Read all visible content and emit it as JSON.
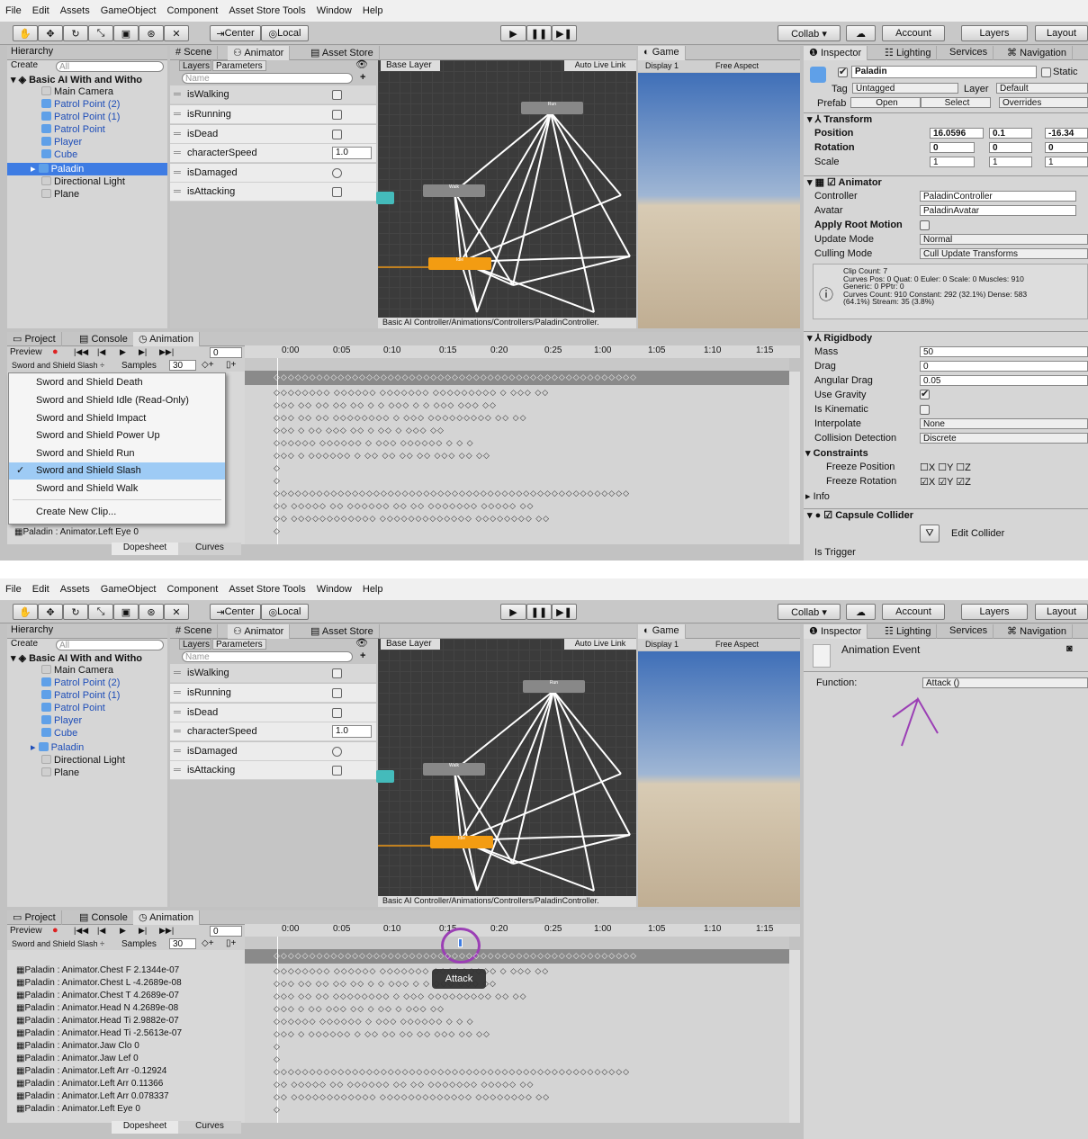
{
  "menu": [
    "File",
    "Edit",
    "Assets",
    "GameObject",
    "Component",
    "Asset Store Tools",
    "Window",
    "Help"
  ],
  "toolbar": {
    "center": "Center",
    "local": "Local",
    "collab": "Collab ▾",
    "account": "Account",
    "layers": "Layers",
    "layout": "Layout"
  },
  "hierarchy": {
    "tab": "Hierarchy",
    "create": "Create",
    "search": "All",
    "scene": "Basic AI With and Witho",
    "items": [
      "Main Camera",
      "Patrol Point (2)",
      "Patrol Point (1)",
      "Patrol Point",
      "Player",
      "Cube",
      "Paladin",
      "Directional Light",
      "Plane"
    ]
  },
  "center_tabs": {
    "scene": "Scene",
    "animator": "Animator",
    "asset_store": "Asset Store",
    "game": "Game",
    "display": "Display 1",
    "aspect": "Free Aspect"
  },
  "animator": {
    "layers": "Layers",
    "parameters": "Parameters",
    "search": "Name",
    "base_layer": "Base Layer",
    "auto_live": "Auto Live Link",
    "params": [
      {
        "name": "isWalking",
        "type": "bool"
      },
      {
        "name": "isRunning",
        "type": "bool"
      },
      {
        "name": "isDead",
        "type": "bool"
      },
      {
        "name": "characterSpeed",
        "type": "float",
        "value": "1.0"
      },
      {
        "name": "isDamaged",
        "type": "trigger"
      },
      {
        "name": "isAttacking",
        "type": "bool"
      }
    ],
    "path": "Basic AI Controller/Animations/Controllers/PaladinController."
  },
  "inspector": {
    "tab": "Inspector",
    "lighting": "Lighting",
    "services": "Services",
    "navigation": "Navigation",
    "object": "Paladin",
    "static": "Static",
    "tag_label": "Tag",
    "tag": "Untagged",
    "layer_label": "Layer",
    "layer": "Default",
    "prefab": "Prefab",
    "open": "Open",
    "select": "Select",
    "overrides": "Overrides",
    "transform": {
      "title": "Transform",
      "position": "Position",
      "rotation": "Rotation",
      "scale": "Scale",
      "px": "16.0596",
      "py": "0.1",
      "pz": "-16.34",
      "rx": "0",
      "ry": "0",
      "rz": "0",
      "sx": "1",
      "sy": "1",
      "sz": "1"
    },
    "animator": {
      "title": "Animator",
      "controller_label": "Controller",
      "controller": "PaladinController",
      "avatar_label": "Avatar",
      "avatar": "PaladinAvatar",
      "root_motion": "Apply Root Motion",
      "update_label": "Update Mode",
      "update": "Normal",
      "culling_label": "Culling Mode",
      "culling": "Cull Update Transforms",
      "info": "Clip Count: 7\nCurves Pos: 0 Quat: 0 Euler: 0 Scale: 0 Muscles: 910\nGeneric: 0 PPtr: 0\nCurves Count: 910 Constant: 292 (32.1%) Dense: 583\n(64.1%) Stream: 35 (3.8%)"
    },
    "rigidbody": {
      "title": "Rigidbody",
      "mass_label": "Mass",
      "mass": "50",
      "drag_label": "Drag",
      "drag": "0",
      "adrag_label": "Angular Drag",
      "adrag": "0.05",
      "gravity": "Use Gravity",
      "kinematic": "Is Kinematic",
      "interp_label": "Interpolate",
      "interp": "None",
      "coll_label": "Collision Detection",
      "coll": "Discrete",
      "constraints": "Constraints",
      "freeze_pos": "Freeze Position",
      "freeze_rot": "Freeze Rotation",
      "info": "Info"
    },
    "capsule": {
      "title": "Capsule Collider",
      "edit": "Edit Collider",
      "trigger": "Is Trigger"
    }
  },
  "bottom_tabs": {
    "project": "Project",
    "console": "Console",
    "animation": "Animation"
  },
  "animation": {
    "preview": "Preview",
    "frame": "0",
    "clip": "Sword and Shield Slash",
    "samples_label": "Samples",
    "samples": "30",
    "ticks": [
      "0:00",
      "0:05",
      "0:10",
      "0:15",
      "0:20",
      "0:25",
      "1:00",
      "1:05",
      "1:10",
      "1:15"
    ],
    "dopesheet": "Dopesheet",
    "curves": "Curves",
    "clips": [
      "Sword and Shield Death",
      "Sword and Shield Idle (Read-Only)",
      "Sword and Shield Impact",
      "Sword and Shield Power Up",
      "Sword and Shield Run",
      "Sword and Shield Slash",
      "Sword and Shield Walk"
    ],
    "new_clip": "Create New Clip...",
    "last_track": {
      "name": "Paladin : Animator.Left Eye",
      "value": "0"
    },
    "tracks": [
      {
        "name": "Paladin : Animator.Chest F",
        "value": "2.1344e-07"
      },
      {
        "name": "Paladin : Animator.Chest L",
        "value": "-4.2689e-08"
      },
      {
        "name": "Paladin : Animator.Chest T",
        "value": "4.2689e-07"
      },
      {
        "name": "Paladin : Animator.Head N",
        "value": "4.2689e-08"
      },
      {
        "name": "Paladin : Animator.Head Ti",
        "value": "2.9882e-07"
      },
      {
        "name": "Paladin : Animator.Head Ti",
        "value": "-2.5613e-07"
      },
      {
        "name": "Paladin : Animator.Jaw Clo",
        "value": "0"
      },
      {
        "name": "Paladin : Animator.Jaw Lef",
        "value": "0"
      },
      {
        "name": "Paladin : Animator.Left Arr",
        "value": "-0.12924"
      },
      {
        "name": "Paladin : Animator.Left Arr",
        "value": "0.11366"
      },
      {
        "name": "Paladin : Animator.Left Arr",
        "value": "0.078337"
      },
      {
        "name": "Paladin : Animator.Left Eye",
        "value": "0"
      }
    ],
    "event_tooltip": "Attack"
  },
  "event_inspector": {
    "title": "Animation Event",
    "function_label": "Function:",
    "function": "Attack ()"
  },
  "colors": {
    "accent": "#3e7ce3",
    "annotation": "#9b3fb5",
    "entry_node": "#f39c12"
  }
}
